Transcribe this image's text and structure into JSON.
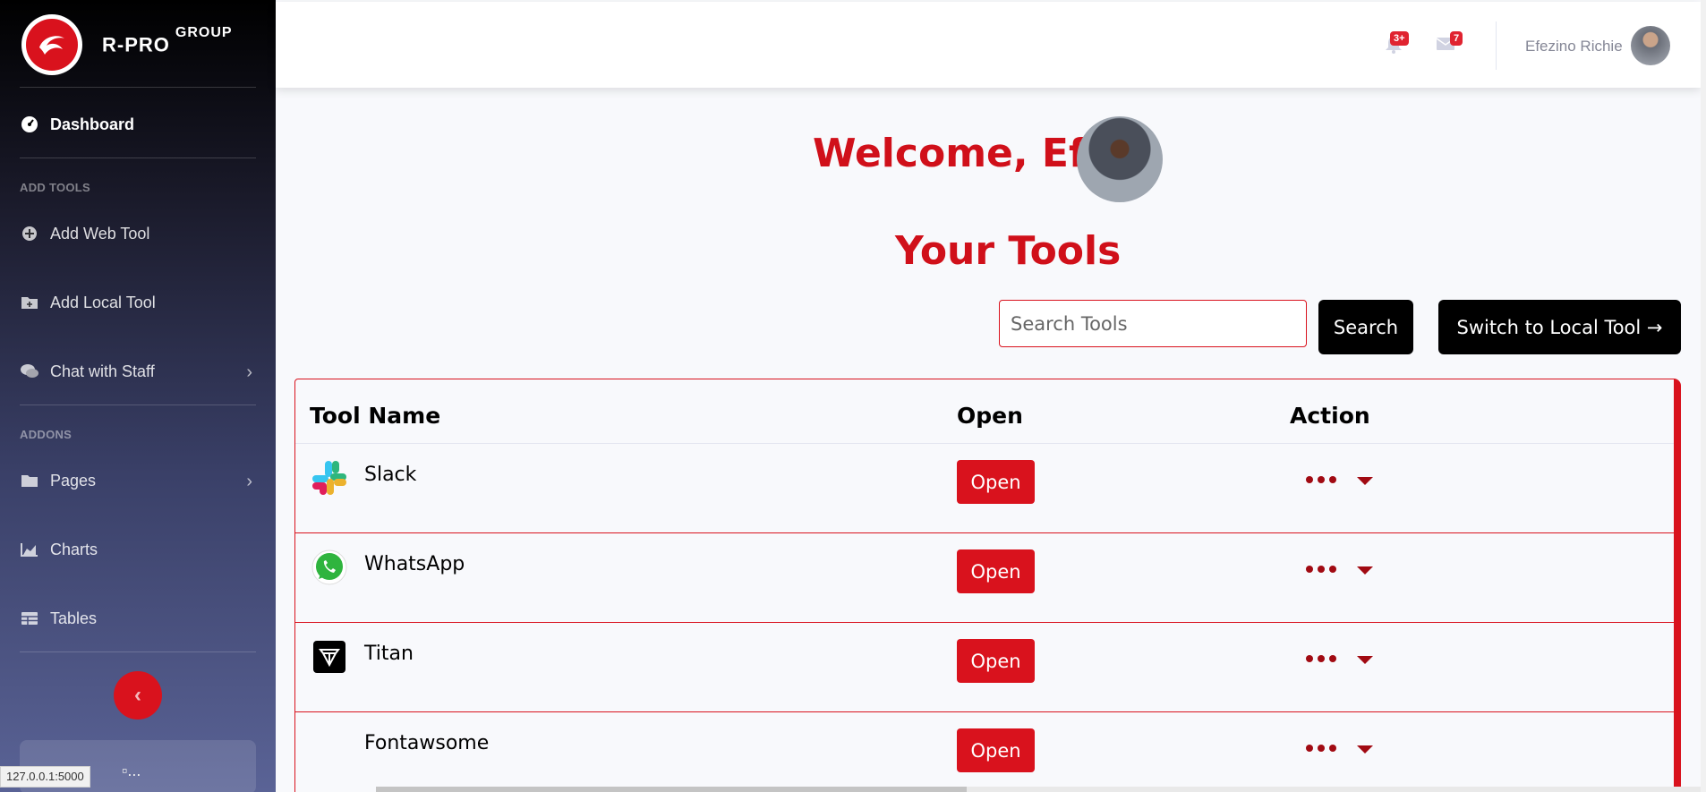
{
  "brand": {
    "name": "R-PRO",
    "suffix": "GROUP"
  },
  "sidebar": {
    "dashboard": "Dashboard",
    "heading_add_tools": "ADD TOOLS",
    "add_web_tool": "Add Web Tool",
    "add_local_tool": "Add Local Tool",
    "chat_with_staff": "Chat with Staff",
    "heading_addons": "ADDONS",
    "pages": "Pages",
    "charts": "Charts",
    "tables": "Tables",
    "card_image_alt": "..."
  },
  "topbar": {
    "alerts_badge": "3+",
    "messages_badge": "7",
    "user_name": "Efezino Richie"
  },
  "main": {
    "welcome": "Welcome, Efe!",
    "section_title": "Your Tools",
    "search_placeholder": "Search Tools",
    "search_button": "Search",
    "switch_button": "Switch to Local Tool →"
  },
  "table": {
    "headers": [
      "Tool Name",
      "Open",
      "Action"
    ],
    "open_label": "Open",
    "rows": [
      {
        "name": "Slack",
        "icon": "slack-icon"
      },
      {
        "name": "WhatsApp",
        "icon": "whatsapp-icon"
      },
      {
        "name": "Titan",
        "icon": "titan-icon"
      },
      {
        "name": "Fontawsome",
        "icon": ""
      }
    ]
  },
  "status_bar": {
    "url": "127.0.0.1:5000"
  },
  "colors": {
    "accent": "#d9121d",
    "dark_red": "#a10a12",
    "black": "#000000"
  }
}
